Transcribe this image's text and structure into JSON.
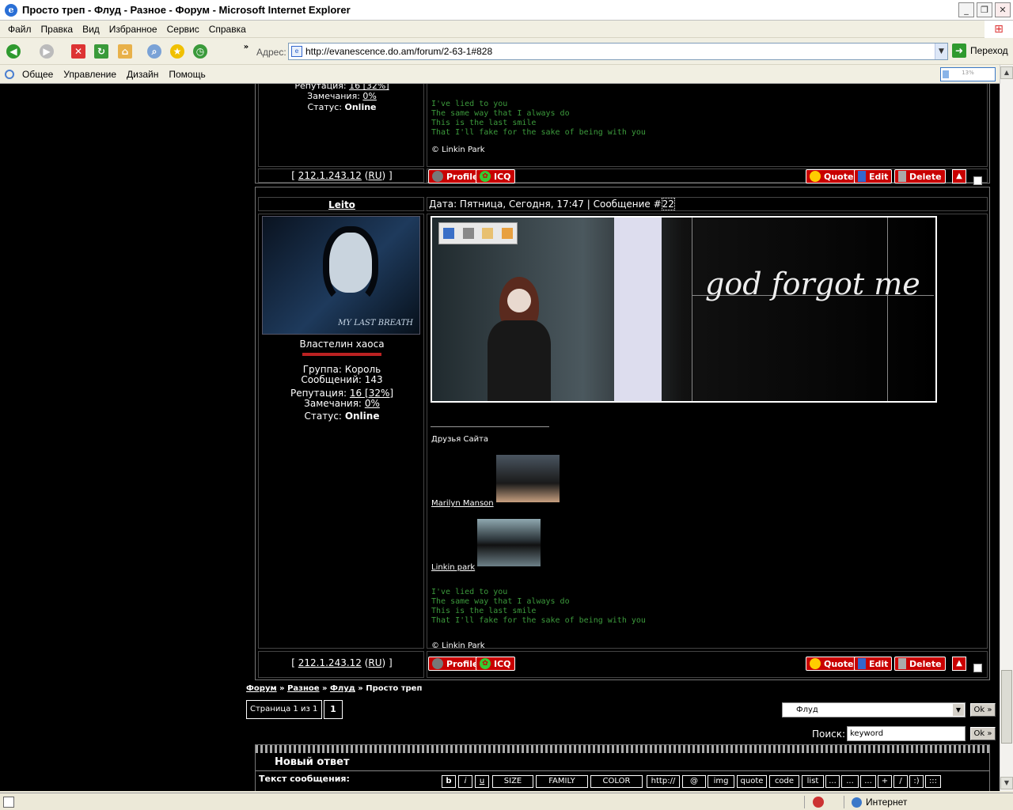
{
  "window": {
    "title": "Просто треп - Флуд - Разное - Форум - Microsoft Internet Explorer",
    "controls": [
      "_",
      "❐",
      "✕"
    ]
  },
  "menu": [
    "Файл",
    "Правка",
    "Вид",
    "Избранное",
    "Сервис",
    "Справка"
  ],
  "address": {
    "label": "Адрес:",
    "url": "http://evanescence.do.am/forum/2-63-1#828",
    "go": "Переход"
  },
  "links": [
    "Общее",
    "Управление",
    "Дизайн",
    "Помощь"
  ],
  "zoom": "13%",
  "post1": {
    "reputation_label": "Репутация:",
    "reputation": "16 [32%]",
    "remarks_label": "Замечания:",
    "remarks": "0%",
    "status_label": "Статус:",
    "status": "Online",
    "lyrics": [
      "I've lied to you",
      "The same way that I always do",
      "This is the last smile",
      "That I'll fake for the sake of being with you"
    ],
    "sig": "© Linkin Park",
    "ip": "212.1.243.12",
    "country": "RU"
  },
  "post2": {
    "user": "Leito",
    "date_label": "Дата: Пятница, Сегодня, 17:47 | Сообщение #",
    "msg_no": "22",
    "avatar_caption": "MY LAST BREATH",
    "rank": "Властелин хаоса",
    "group_label": "Группа:",
    "group": "Король",
    "messages_label": "Сообщений:",
    "messages": "143",
    "reputation_label": "Репутация:",
    "reputation": "16 [32%]",
    "remarks_label": "Замечания:",
    "remarks": "0%",
    "status_label": "Статус:",
    "status": "Online",
    "banner_text": "god forgot me",
    "friends_title": "Друзья Сайта",
    "friend1": "Marilyn Manson",
    "friend2": "Linkin park",
    "lyrics": [
      "I've lied to you",
      "The same way that I always do",
      "This is the last smile",
      "That I'll fake for the sake of being with you"
    ],
    "sig": "© Linkin Park",
    "ip": "212.1.243.12",
    "country": "RU"
  },
  "buttons": {
    "profile": "Profile",
    "icq": "ICQ",
    "quote": "Quote",
    "edit": "Edit",
    "delete": "Delete"
  },
  "breadcrumb": {
    "a": "Форум",
    "b": "Разное",
    "c": "Флуд",
    "d": "Просто треп",
    "sep": "»"
  },
  "pages": {
    "label": "Страница 1 из 1",
    "current": "1"
  },
  "jump": {
    "value": "Флуд",
    "ok": "Ok »"
  },
  "search": {
    "label": "Поиск:",
    "value": "keyword",
    "ok": "Ok »"
  },
  "reply": {
    "title": "Новый ответ",
    "text_label": "Текст сообщения:"
  },
  "editor": [
    "b",
    "i",
    "u",
    "SIZE",
    "FAMILY",
    "COLOR",
    "http://",
    "@",
    "img",
    "quote",
    "code",
    "list",
    "...",
    "...",
    "...",
    "+",
    "/",
    ":)",
    ":::"
  ],
  "statusbar": {
    "zone": "Интернет"
  }
}
